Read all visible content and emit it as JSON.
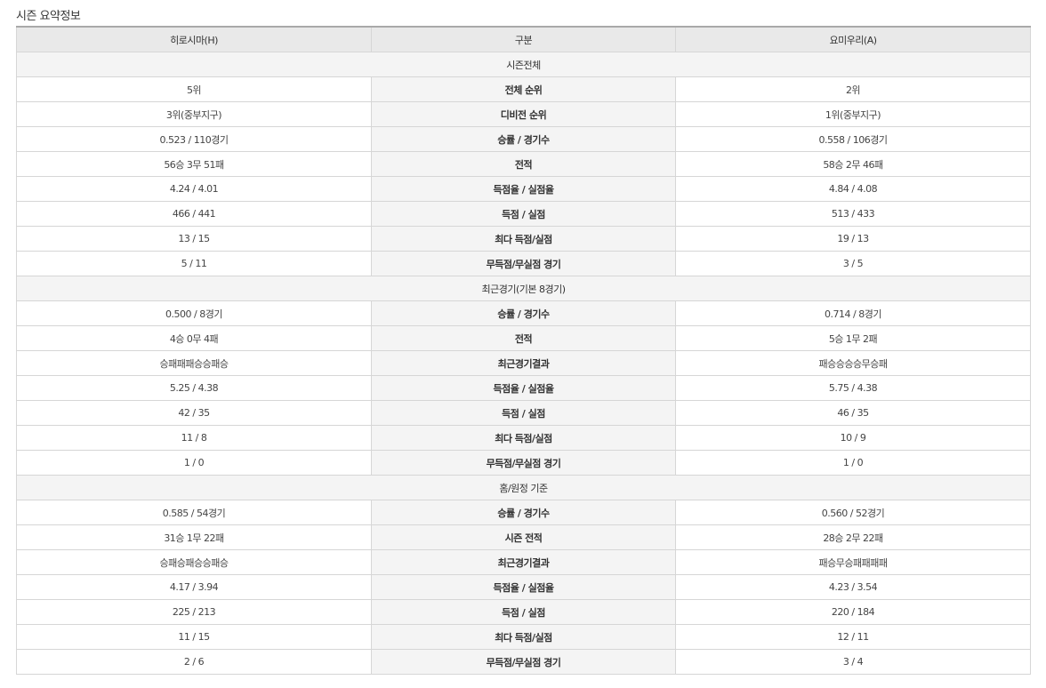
{
  "title": "시즌 요약정보",
  "headers": {
    "home": "히로시마(H)",
    "category": "구분",
    "away": "요미우리(A)"
  },
  "sections": [
    {
      "name": "시즌전체",
      "rows": [
        {
          "label": "전체 순위",
          "home": "5위",
          "away": "2위"
        },
        {
          "label": "디비전 순위",
          "home": "3위(중부지구)",
          "away": "1위(중부지구)"
        },
        {
          "label": "승률 / 경기수",
          "home": "0.523 / 110경기",
          "away": "0.558 / 106경기"
        },
        {
          "label": "전적",
          "home": "56승 3무 51패",
          "away": "58승 2무 46패"
        },
        {
          "label": "득점율 / 실점율",
          "home": "4.24 / 4.01",
          "away": "4.84 / 4.08"
        },
        {
          "label": "득점 / 실점",
          "home": "466 / 441",
          "away": "513 / 433"
        },
        {
          "label": "최다 득점/실점",
          "home": "13 / 15",
          "away": "19 / 13"
        },
        {
          "label": "무득점/무실점 경기",
          "home": "5 / 11",
          "away": "3 / 5"
        }
      ]
    },
    {
      "name": "최근경기(기본 8경기)",
      "rows": [
        {
          "label": "승률 / 경기수",
          "home": "0.500 / 8경기",
          "away": "0.714 / 8경기"
        },
        {
          "label": "전적",
          "home": "4승 0무 4패",
          "away": "5승 1무 2패"
        },
        {
          "label": "최근경기결과",
          "home": "승패패패승승패승",
          "away": "패승승승승무승패"
        },
        {
          "label": "득점율 / 실점율",
          "home": "5.25 / 4.38",
          "away": "5.75 / 4.38"
        },
        {
          "label": "득점 / 실점",
          "home": "42 / 35",
          "away": "46 / 35"
        },
        {
          "label": "최다 득점/실점",
          "home": "11 / 8",
          "away": "10 / 9"
        },
        {
          "label": "무득점/무실점 경기",
          "home": "1 / 0",
          "away": "1 / 0"
        }
      ]
    },
    {
      "name": "홈/원정 기준",
      "rows": [
        {
          "label": "승률 / 경기수",
          "home": "0.585 / 54경기",
          "away": "0.560 / 52경기"
        },
        {
          "label": "시즌 전적",
          "home": "31승 1무 22패",
          "away": "28승 2무 22패"
        },
        {
          "label": "최근경기결과",
          "home": "승패승패승승패승",
          "away": "패승무승패패패패"
        },
        {
          "label": "득점율 / 실점율",
          "home": "4.17 / 3.94",
          "away": "4.23 / 3.54"
        },
        {
          "label": "득점 / 실점",
          "home": "225 / 213",
          "away": "220 / 184"
        },
        {
          "label": "최다 득점/실점",
          "home": "11 / 15",
          "away": "12 / 11"
        },
        {
          "label": "무득점/무실점 경기",
          "home": "2 / 6",
          "away": "3 / 4"
        }
      ]
    }
  ]
}
